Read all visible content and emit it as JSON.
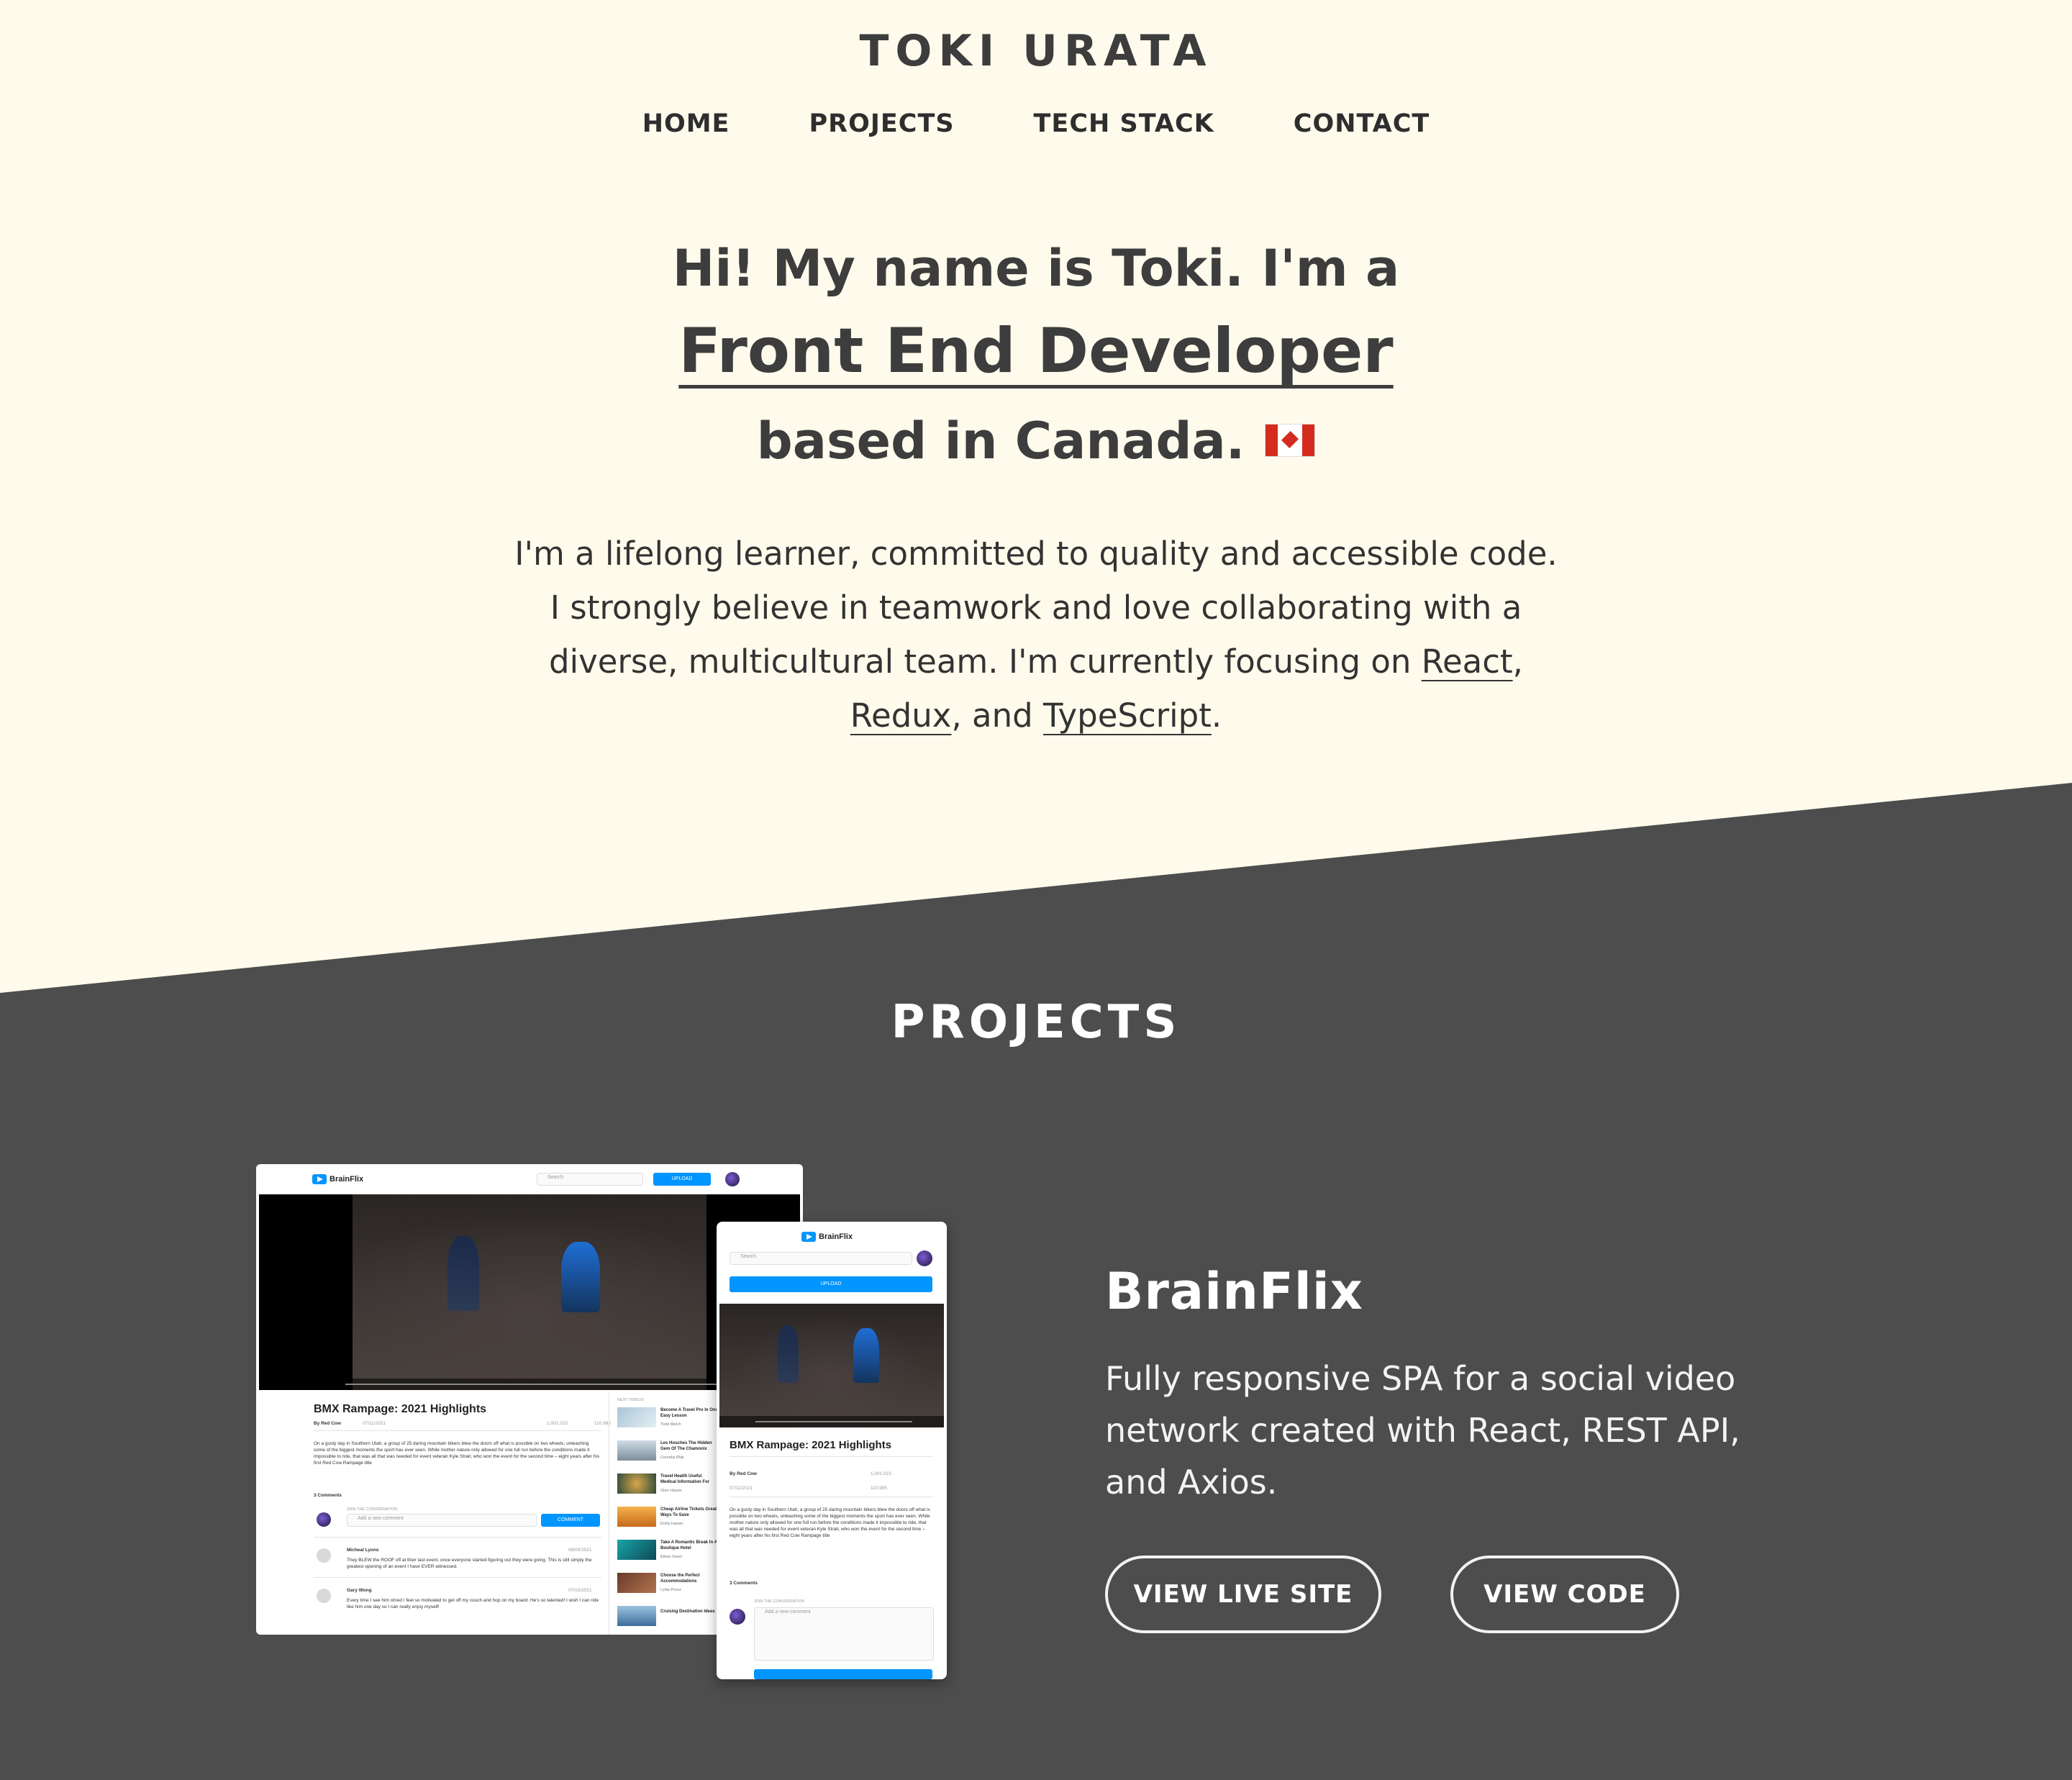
{
  "brand": "TOKI URATA",
  "nav": [
    "HOME",
    "PROJECTS",
    "TECH STACK",
    "CONTACT"
  ],
  "hero": {
    "line1": "Hi! My name is Toki. I'm a",
    "line2": "Front End Developer",
    "line3": "based in Canada.",
    "flag_icon": "canada-flag-icon"
  },
  "intro": {
    "l1": "I'm a lifelong learner, committed to quality and accessible code.",
    "l2": "I strongly believe in teamwork and love collaborating with a",
    "l3_pre": "diverse, multicultural team. I'm currently focusing on ",
    "l3_link": "React",
    "l3_post": ",",
    "l4_link1": "Redux",
    "l4_mid": ", and ",
    "l4_link2": "TypeScript",
    "l4_post": "."
  },
  "projects": {
    "title": "PROJECTS",
    "items": [
      {
        "name": "BrainFlix",
        "description": "Fully responsive SPA for a social video network created with React, REST API, and Axios.",
        "live_label": "VIEW LIVE SITE",
        "code_label": "VIEW CODE"
      }
    ]
  },
  "mockup": {
    "logo": "BrainFlix",
    "search_placeholder": "Search",
    "upload_label": "UPLOAD",
    "video_title": "BMX Rampage: 2021 Highlights",
    "author": "By Red Cow",
    "date": "07/11/2021",
    "views": "1,001,023",
    "likes": "110,985",
    "desc": "On a gusty day in Southern Utah, a group of 25 daring mountain bikers blew the doors off what is possible on two wheels, unleashing some of the biggest moments the sport has ever seen. While mother nature only allowed for one full run before the conditions made it impossible to ride, that was all that was needed for event veteran Kyle Strait, who won the event for the second time – eight years after his first Red Cow Rampage title",
    "comments_count": "3 Comments",
    "join_label": "JOIN THE CONVERSATION",
    "comment_placeholder": "Add a new comment",
    "comment_button": "COMMENT",
    "next_videos_label": "NEXT VIDEOS",
    "comments": [
      {
        "name": "Micheal Lyons",
        "date": "08/09/2021",
        "text": "They BLEW the ROOF off at their last event, once everyone started figuring out they were going. This is still simply the greatest opening of an event I have EVER witnessed."
      },
      {
        "name": "Gary Wong",
        "date": "07/15/2021",
        "text": "Every time I see him shred I feel so motivated to get off my couch and hop on my board. He's so talented! I wish I can ride like him one day so I can really enjoy myself!"
      }
    ],
    "next_videos": [
      {
        "title": "Become A Travel Pro In One Easy Lesson",
        "author": "Todd Welch"
      },
      {
        "title": "Les Houches The Hidden Gem Of The Chamonix",
        "author": "Cornelia Blair"
      },
      {
        "title": "Travel Health Useful Medical Information For",
        "author": "Glen Harper"
      },
      {
        "title": "Cheap Airline Tickets Great Ways To Save",
        "author": "Emily Harper"
      },
      {
        "title": "Take A Romantic Break In A Boutique Hotel",
        "author": "Ethan Owen"
      },
      {
        "title": "Choose the Perfect Accommodations",
        "author": "Lydia Perez"
      },
      {
        "title": "Cruising Destination Ideas",
        "author": "Timothy Austin"
      }
    ]
  }
}
